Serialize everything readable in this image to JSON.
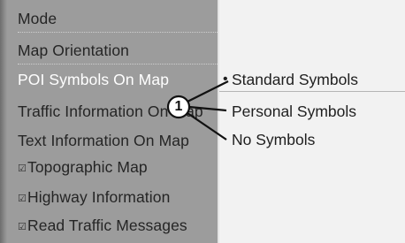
{
  "menu": {
    "items": [
      {
        "label": "Mode",
        "checkable": false,
        "active": false
      },
      {
        "label": "Map Orientation",
        "checkable": false,
        "active": false
      },
      {
        "label": "POI Symbols On Map",
        "checkable": false,
        "active": true
      },
      {
        "label": "Traffic Information On Map",
        "checkable": false,
        "active": false
      },
      {
        "label": "Text Information On Map",
        "checkable": false,
        "active": false
      },
      {
        "label": "Topographic Map",
        "checkable": true,
        "active": false
      },
      {
        "label": "Highway Information",
        "checkable": true,
        "active": false
      },
      {
        "label": "Read Traffic Messages",
        "checkable": true,
        "active": false
      }
    ],
    "check_glyph": "☑"
  },
  "options": {
    "items": [
      {
        "label": "Standard Symbols",
        "selected": true
      },
      {
        "label": "Personal Symbols",
        "selected": false
      },
      {
        "label": "No Symbols",
        "selected": false
      }
    ],
    "bullet_glyph": "•"
  },
  "callout": {
    "number": "1"
  },
  "colors": {
    "menu_background": "#9c9c9c",
    "options_background": "#f2f2f2",
    "active_text": "#ffffff",
    "text": "#252525"
  }
}
